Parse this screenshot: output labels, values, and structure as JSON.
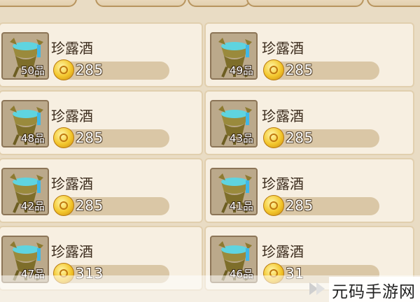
{
  "tabs": [
    {
      "id": "tab-1"
    },
    {
      "id": "tab-2"
    },
    {
      "id": "tab-3"
    },
    {
      "id": "tab-4"
    },
    {
      "id": "tab-5"
    }
  ],
  "items": [
    {
      "name": "珍露酒",
      "grade": "50品",
      "price": "285"
    },
    {
      "name": "珍露酒",
      "grade": "49品",
      "price": "285"
    },
    {
      "name": "珍露酒",
      "grade": "48品",
      "price": "285"
    },
    {
      "name": "珍露酒",
      "grade": "43品",
      "price": "285"
    },
    {
      "name": "珍露酒",
      "grade": "42品",
      "price": "285"
    },
    {
      "name": "珍露酒",
      "grade": "41品",
      "price": "285"
    },
    {
      "name": "珍露酒",
      "grade": "47品",
      "price": "313"
    },
    {
      "name": "珍露酒",
      "grade": "46品",
      "price": "31"
    }
  ],
  "icons": {
    "item": "bronze-wine-vessel-icon",
    "currency": "gold-coin-icon"
  },
  "colors": {
    "card": "#f7efe1",
    "bar": "#dac7a6",
    "coin": "#f3c62c"
  },
  "watermark": {
    "text": "元码手游网"
  }
}
